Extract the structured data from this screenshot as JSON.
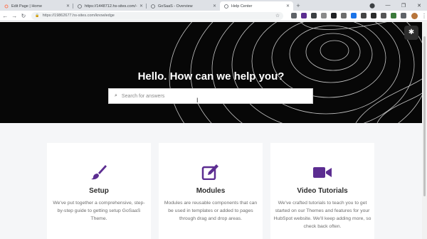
{
  "tabs": [
    {
      "title": "Edit Page | Home",
      "icon": "hubspot-sprocket-icon"
    },
    {
      "title": "https://1448712.hs-sites.com/-...",
      "icon": "globe-icon"
    },
    {
      "title": "GoSaaS - Overview",
      "icon": "globe-icon"
    },
    {
      "title": "Help Center",
      "icon": "globe-icon",
      "active": true
    }
  ],
  "toolbar": {
    "url": "https://19862677.hs-sites.com/knowledge"
  },
  "hero": {
    "title": "Hello. How can we help you?",
    "search_placeholder": "Search for answers"
  },
  "cards": [
    {
      "icon": "paintbrush-icon",
      "title": "Setup",
      "text": "We've put together a comprehensive, step-by-step guide to getting setup GoSaaS Theme."
    },
    {
      "icon": "edit-square-icon",
      "title": "Modules",
      "text": "Modules are reusable components that can be used in templates or added to pages through drag and drop areas."
    },
    {
      "icon": "video-camera-icon",
      "title": "Video Tutorials",
      "text": "We've crafted tutorials to teach you to get started on our Themes and features for your HubSpot website. We'll keep adding more, so check back often."
    }
  ],
  "colors": {
    "accent": "#5c2d91",
    "hero_bg": "#070707",
    "section_bg": "#f5f6f8"
  }
}
